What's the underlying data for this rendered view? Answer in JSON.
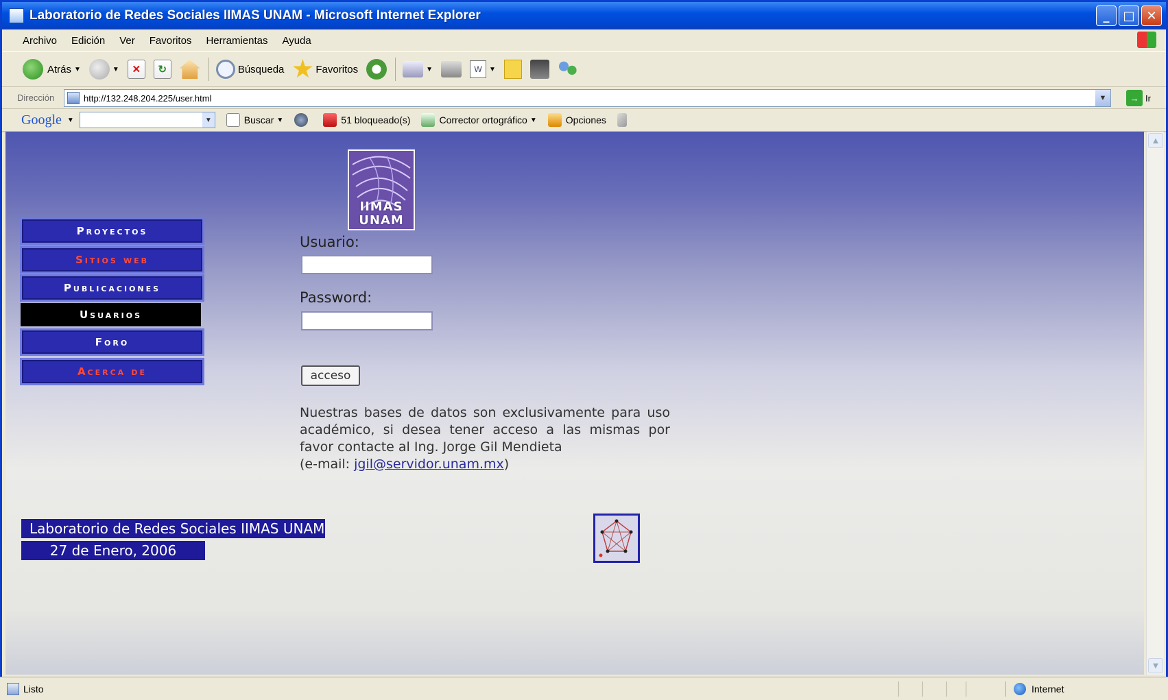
{
  "window": {
    "title": "Laboratorio de Redes Sociales IIMAS UNAM - Microsoft Internet Explorer",
    "controls": [
      "minimize",
      "maximize",
      "close"
    ]
  },
  "menubar": {
    "items": [
      "Archivo",
      "Edición",
      "Ver",
      "Favoritos",
      "Herramientas",
      "Ayuda"
    ]
  },
  "toolbar": {
    "back_label": "Atrás",
    "search_label": "Búsqueda",
    "favorites_label": "Favoritos"
  },
  "addressbar": {
    "label": "Dirección",
    "url": "http://132.248.204.225/user.html",
    "go_label": "Ir"
  },
  "google_toolbar": {
    "logo": "Google",
    "search_value": "",
    "search_label": "Buscar",
    "blocked_label": "51 bloqueado(s)",
    "spell_label": "Corrector ortográfico",
    "options_label": "Opciones"
  },
  "page": {
    "logo_text_line1": "IIMAS",
    "logo_text_line2": "UNAM",
    "nav": [
      {
        "label": "Proyectos",
        "style": "normal"
      },
      {
        "label": "Sitios web",
        "style": "red"
      },
      {
        "label": "Publicaciones",
        "style": "normal"
      },
      {
        "label": "Usuarios",
        "style": "active"
      },
      {
        "label": "Foro",
        "style": "normal"
      },
      {
        "label": "Acerca de",
        "style": "red"
      }
    ],
    "login": {
      "user_label": "Usuario:",
      "user_value": "",
      "password_label": "Password:",
      "password_value": "",
      "submit_label": "acceso"
    },
    "info_text": "Nuestras bases de datos son exclusivamente para uso académico, si desea tener acceso a las mismas por favor contacte al Ing. Jorge Gil Mendieta",
    "email_prefix": "(e-mail: ",
    "email": "jgil@servidor.unam.mx",
    "email_suffix": ")",
    "footer_title": "Laboratorio de Redes Sociales IIMAS UNAM",
    "footer_date": "27 de Enero, 2006"
  },
  "statusbar": {
    "status": "Listo",
    "zone": "Internet"
  }
}
